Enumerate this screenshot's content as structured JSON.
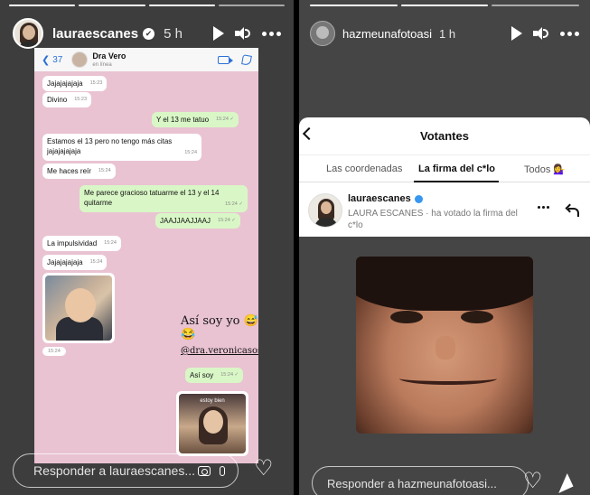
{
  "left_story": {
    "username": "lauraescanes",
    "verified_mark": "✔",
    "time": "5 h",
    "progress_segments": 4,
    "progress_done": 3,
    "whatsapp": {
      "back_count": "37",
      "contact_name": "Dra Vero",
      "contact_status": "en línea",
      "messages": [
        {
          "dir": "in",
          "text": "Jajajajajaja",
          "time": "15:23"
        },
        {
          "dir": "in",
          "text": "Divino",
          "time": "15:23"
        },
        {
          "dir": "out",
          "text": "Y el 13 me tatuo",
          "time": "15:24 ✓"
        },
        {
          "dir": "in",
          "text": "Estamos el 13 pero no tengo más citas jajajajajaja",
          "time": "15:24"
        },
        {
          "dir": "in",
          "text": "Me haces reír",
          "time": "15:24"
        },
        {
          "dir": "out",
          "text": "Me parece gracioso tatuarme el 13 y el 14 quitarme",
          "time": "15:24 ✓"
        },
        {
          "dir": "out",
          "text": "JAAJJAAJJAAJ",
          "time": "15:24 ✓"
        },
        {
          "dir": "in",
          "text": "La impulsividad",
          "time": "15:24"
        },
        {
          "dir": "in",
          "text": "Jajajajajaja",
          "time": "15:24"
        },
        {
          "dir": "out",
          "text": "Así soy",
          "time": "15:24 ✓"
        }
      ],
      "photo_time": "15:24",
      "sticker_caption": "estoy bien"
    },
    "caption_line1": "Así soy yo 😅😂😂😂",
    "caption_line2": "@dra.veronicasosaviain",
    "reply_placeholder": "Responder a lauraescanes..."
  },
  "right_story": {
    "username": "hazmeunafotoasi",
    "time": "1 h",
    "progress_segments": 3,
    "progress_done": 2,
    "card_title": "Votantes",
    "tabs": [
      "Las coordenadas",
      "La firma del c*lo",
      "Todos 💁‍♀️"
    ],
    "active_tab": 1,
    "voter_name": "lauraescanes",
    "voter_desc": "LAURA ESCANES · ha votado la firma del c*lo",
    "reply_placeholder": "Responder a hazmeunafotoasi..."
  },
  "colors": {
    "chat_bg": "#e9c3d2",
    "bubble_out": "#d9f7c6",
    "verified_blue": "#3897f0"
  },
  "icons": [
    "play-icon",
    "speaker-icon",
    "more-icon",
    "camera-icon",
    "mic-icon",
    "heart-icon",
    "send-icon",
    "back-icon",
    "reply-icon"
  ]
}
